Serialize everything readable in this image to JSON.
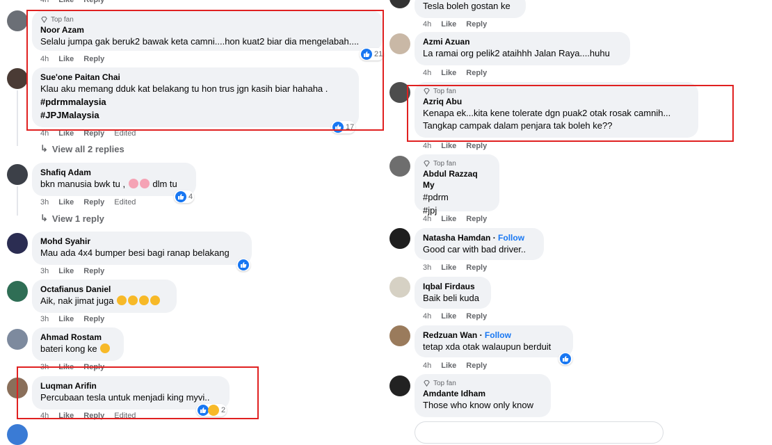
{
  "labels": {
    "like": "Like",
    "reply": "Reply",
    "edited": "Edited",
    "top_fan": "Top fan",
    "follow": "Follow"
  },
  "top_left_meta": {
    "time": "4h"
  },
  "top_right": {
    "text": "Tesla boleh gostan ke"
  },
  "left_comments": [
    {
      "author": "Noor Azam",
      "top_fan": true,
      "lines": [
        "Selalu jumpa gak beruk2 bawak keta camni....hon kuat2 biar dia mengelabah...."
      ],
      "time": "4h",
      "edited": false,
      "reactions": "21"
    },
    {
      "author": "Sue'one Paitan Chai",
      "top_fan": false,
      "lines": [
        "Klau aku memang dduk kat belakang tu hon trus jgn kasih biar hahaha ."
      ],
      "hashtags": [
        "#pdrmmalaysia",
        "#JPJMalaysia"
      ],
      "time": "4h",
      "edited": true,
      "reactions": "17"
    },
    {
      "author": "Shafiq Adam",
      "top_fan": false,
      "lines": [
        "bkn manusia bwk tu , ",
        " dlm tu"
      ],
      "time": "3h",
      "edited": true,
      "reactions": "4"
    },
    {
      "author": "Mohd Syahir",
      "top_fan": false,
      "lines": [
        "Mau ada 4x4 bumper besi bagi ranap belakang"
      ],
      "time": "3h",
      "edited": false,
      "reactions": ""
    },
    {
      "author": "Octafianus Daniel",
      "top_fan": false,
      "lines": [
        "Aik, nak jimat juga "
      ],
      "time": "3h",
      "edited": false,
      "reactions": ""
    },
    {
      "author": "Ahmad Rostam",
      "top_fan": false,
      "lines": [
        "bateri kong ke "
      ],
      "time": "3h",
      "edited": false,
      "reactions": ""
    },
    {
      "author": "Luqman Arifin",
      "top_fan": false,
      "lines": [
        "Percubaan tesla untuk menjadi king myvi.."
      ],
      "time": "4h",
      "edited": true,
      "reactions": "2"
    }
  ],
  "view_replies": {
    "first": "View all 2 replies",
    "second": "View 1 reply"
  },
  "right_comments": [
    {
      "author": "Azmi Azuan",
      "top_fan": false,
      "follow": false,
      "lines": [
        "La ramai org pelik2 ataihhh Jalan Raya....huhu"
      ],
      "time": "4h"
    },
    {
      "author": "Azriq Abu",
      "top_fan": true,
      "follow": false,
      "lines": [
        "Kenapa ek...kita kene tolerate dgn puak2 otak rosak camnih...",
        "Tangkap campak dalam penjara tak boleh ke??"
      ],
      "time": "4h"
    },
    {
      "author": "Abdul Razzaq My",
      "top_fan": true,
      "follow": false,
      "hashtags": [
        "#pdrm",
        "#jpj"
      ],
      "lines": [],
      "time": "4h"
    },
    {
      "author": "Natasha Hamdan",
      "top_fan": false,
      "follow": true,
      "lines": [
        "Good car with bad driver.."
      ],
      "time": "3h"
    },
    {
      "author": "Iqbal Firdaus",
      "top_fan": false,
      "follow": false,
      "lines": [
        "Baik beli kuda"
      ],
      "time": "4h"
    },
    {
      "author": "Redzuan Wan",
      "top_fan": false,
      "follow": true,
      "lines": [
        "tetap xda otak walaupun berduit"
      ],
      "time": "4h",
      "reactions": ""
    },
    {
      "author": "Amdante Idham",
      "top_fan": true,
      "follow": false,
      "lines": [
        "Those who know only know"
      ],
      "time": ""
    }
  ],
  "colors": {
    "accent": "#1877f2",
    "highlight": "#e02020",
    "bubble": "#f0f2f5",
    "muted": "#65676b"
  }
}
